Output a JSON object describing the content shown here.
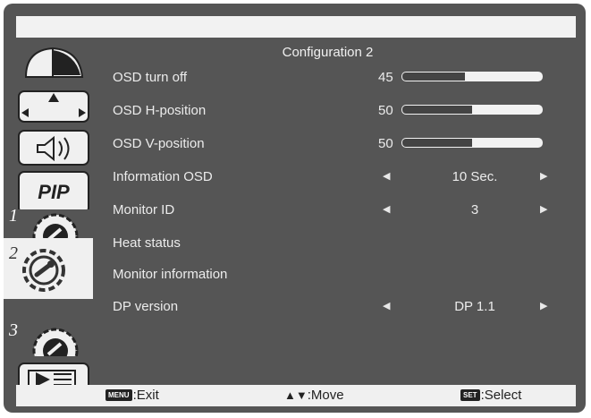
{
  "colors": {
    "frame": "#555555",
    "panel": "#f0f0f0",
    "text": "#ececec"
  },
  "menu": {
    "title": "Configuration 2",
    "items": [
      {
        "label": "OSD turn off",
        "value": "45",
        "type": "slider",
        "level": 0.45
      },
      {
        "label": "OSD H-position",
        "value": "50",
        "type": "slider",
        "level": 0.5
      },
      {
        "label": "OSD V-position",
        "value": "50",
        "type": "slider",
        "level": 0.5
      },
      {
        "label": "Information OSD",
        "value": "10 Sec.",
        "type": "option"
      },
      {
        "label": "Monitor ID",
        "value": "3",
        "type": "option"
      },
      {
        "label": "Heat status",
        "type": "link"
      },
      {
        "label": "Monitor information",
        "type": "link"
      },
      {
        "label": "DP version",
        "value": "DP 1.1",
        "type": "option"
      }
    ]
  },
  "sidebar": {
    "items": [
      {
        "icon": "picture-icon",
        "number": ""
      },
      {
        "icon": "screen-position-icon",
        "number": ""
      },
      {
        "icon": "audio-icon",
        "number": ""
      },
      {
        "icon": "pip-icon",
        "text": "PIP",
        "number": ""
      },
      {
        "icon": "configuration-gear-icon",
        "number": "1"
      },
      {
        "icon": "configuration-gear-icon",
        "number": "2",
        "active": true
      },
      {
        "icon": "configuration-gear-icon",
        "number": "3"
      },
      {
        "icon": "advanced-option-icon",
        "number": ""
      }
    ]
  },
  "footer": {
    "exit_key": "MENU",
    "exit_label": ":Exit",
    "move_key": "▲▼",
    "move_label": ":Move",
    "select_key": "SET",
    "select_label": ":Select"
  }
}
